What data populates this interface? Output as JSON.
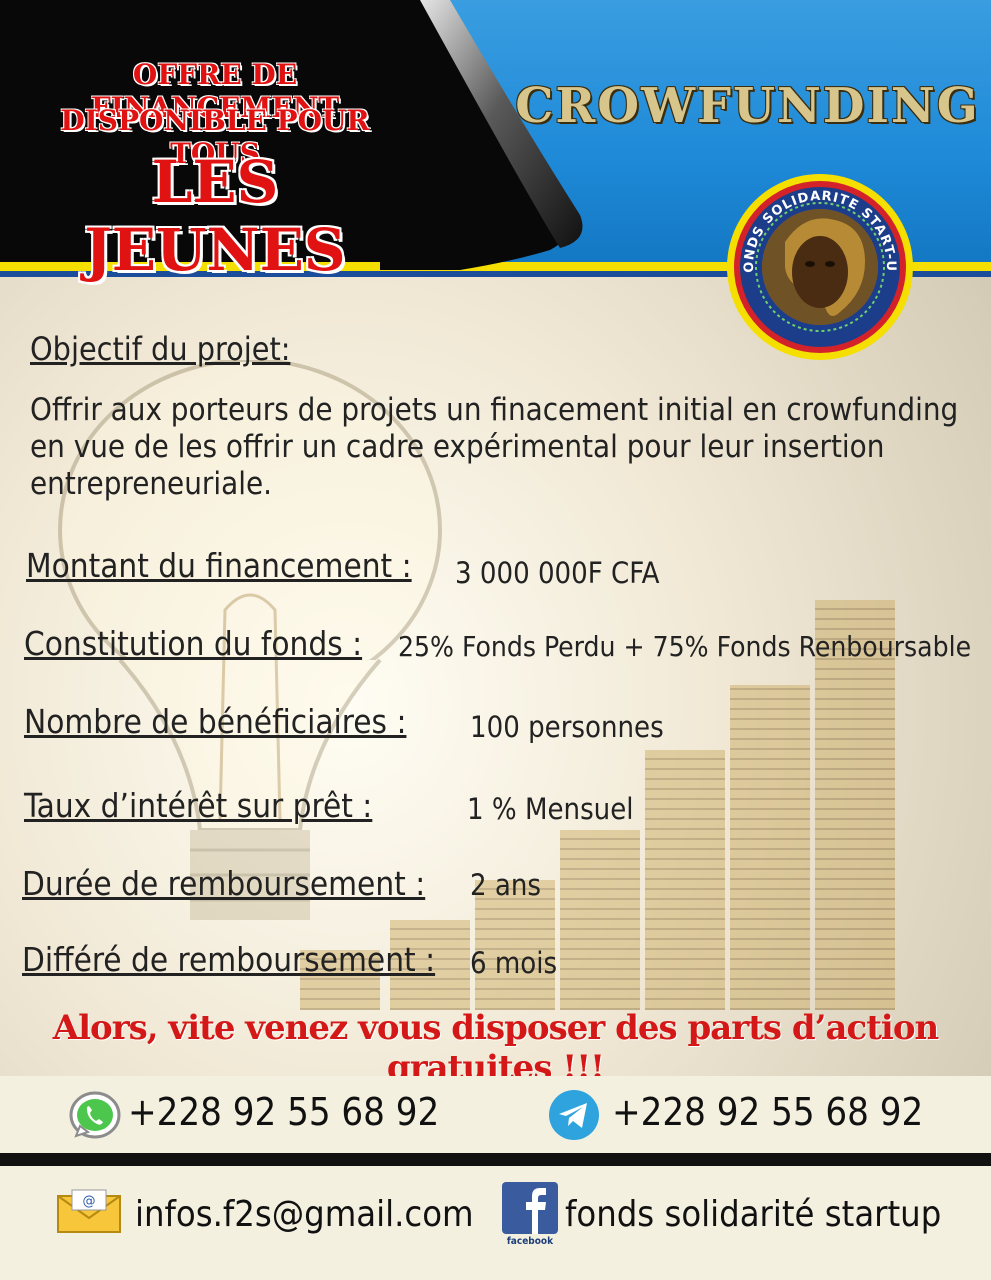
{
  "header": {
    "line1": "OFFRE DE FINANCEMENT",
    "line2": "DISPONIBLE POUR TOUS",
    "line3": "LES JEUNES",
    "crowdfunding": "CROWFUNDING"
  },
  "logo": {
    "ring_text": "FONDS SOLIDARITE START-UP"
  },
  "objective": {
    "heading": "Objectif du projet:",
    "text": "Offrir aux porteurs de projets un finacement initial en crowfunding en vue de les offrir un cadre expérimental pour leur insertion entrepreneuriale."
  },
  "details": {
    "amount": {
      "label": "Montant du financement :",
      "value": "3 000 000F CFA"
    },
    "constitution": {
      "label": "Constitution du fonds :",
      "value": "25% Fonds Perdu + 75% Fonds Renboursable"
    },
    "beneficiaries": {
      "label": "Nombre de bénéficiaires :",
      "value": "100 personnes"
    },
    "interest": {
      "label": "Taux d’intérêt sur prêt :",
      "value": "1 % Mensuel"
    },
    "duration": {
      "label": "Durée de remboursement :",
      "value": "2 ans"
    },
    "deferral": {
      "label": "Différé de remboursement :",
      "value": "6 mois"
    }
  },
  "cta": "Alors, vite venez vous disposer des parts d’action gratuites !!!",
  "contacts": {
    "whatsapp": "+228 92 55 68 92",
    "telegram": "+228 92 55 68 92",
    "email": "infos.f2s@gmail.com",
    "facebook": "fonds solidarité startup",
    "facebook_icon_label": "facebook"
  },
  "colors": {
    "title_red": "#e01212",
    "blue": "#1e8ad8",
    "yellow": "#f4df00",
    "dark_blue": "#1c4d9a"
  }
}
